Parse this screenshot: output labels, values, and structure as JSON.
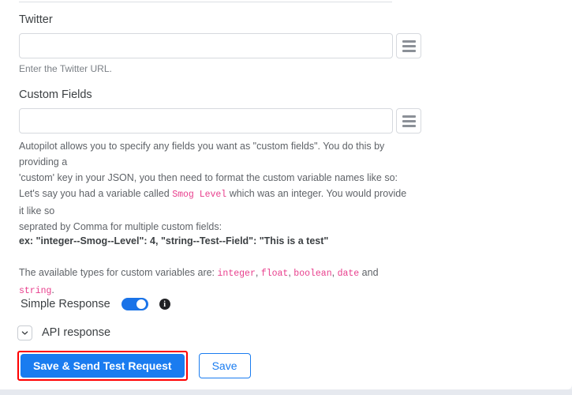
{
  "fields": [
    {
      "label": "Twitter",
      "value": "",
      "placeholder": "",
      "help": "Enter the Twitter URL.",
      "menu_icon": "hamburger-icon"
    },
    {
      "label": "Custom Fields",
      "value": "",
      "placeholder": "",
      "help": "",
      "menu_icon": "hamburger-icon"
    }
  ],
  "descriptions": {
    "intro_line1": "Autopilot allows you to specify any fields you want as \"custom fields\". You do this by providing a",
    "intro_line2": "'custom' key in your JSON, you then need to format the custom variable names like so:",
    "example_pre": "Let's say you had a variable called",
    "example_code": "Smog Level",
    "example_post": "which was an integer. You would provide it like so",
    "example_line2": "seprated by Comma for multiple custom fields:",
    "example_bold": "ex: \"integer--Smog--Level\": 4, \"string--Test--Field\": \"This is a test\"",
    "types_pre": "The available types for custom variables are:",
    "types_list": [
      "integer",
      "float",
      "boolean",
      "date",
      "string"
    ],
    "types_sep": ",",
    "types_conj": "and",
    "types_end": "."
  },
  "simple_response": {
    "label": "Simple Response",
    "toggle_on": true,
    "info_icon": "info-icon",
    "info_glyph": "i"
  },
  "accordion": {
    "label": "API response",
    "expanded": false,
    "chevron_icon": "chevron-down-icon"
  },
  "buttons": {
    "primary_label": "Save & Send Test Request",
    "secondary_label": "Save",
    "primary_highlighted": true
  },
  "colors": {
    "accent_blue": "#1a7cf0",
    "toggle_blue": "#1a73e8",
    "highlight_red": "#ff0000",
    "code_pink": "#e83e8c",
    "text_primary": "#3c4043",
    "text_muted": "#5f6368",
    "border_gray": "#d6d9de"
  }
}
